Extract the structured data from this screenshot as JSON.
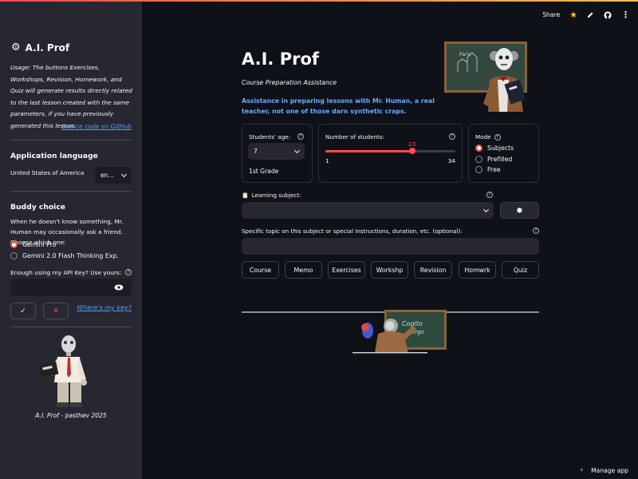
{
  "sidebar": {
    "title": "A.I. Prof",
    "usage": "Usage: The buttons Exercises, Workshops, Revision, Homework, and Quiz will generate results directly related to the last lesson created with the same parameters, if you have previously generated this lesson.",
    "source_link": "Source code on GitHub",
    "app_language_heading": "Application language",
    "language_label": "United States of America",
    "language_value": "en...",
    "buddy_heading": "Buddy choice",
    "buddy_description": "When he doesn't know something, Mr. Human may occasionally ask a friend. Choose which one:",
    "buddy_options": [
      "Gemini Pro",
      "Gemini 2.0 Flash Thinking Exp."
    ],
    "buddy_selected": 0,
    "api_key_label": "Enough using my API Key? Use yours:",
    "confirm_symbol": "✓",
    "cancel_symbol": "✕",
    "where_key_link": "Where's my key?",
    "footer": "A.I. Prof - pasthev 2025"
  },
  "topbar": {
    "share": "Share",
    "icons": [
      "star-icon",
      "edit-icon",
      "github-icon",
      "menu-dots-icon"
    ]
  },
  "main": {
    "title": "A.I. Prof",
    "subtitle": "Course Preparation Assistance",
    "tagline": "Assistance in preparing lessons with Mr. Human, a real teacher, not one of those darn synthetic craps.",
    "age_label": "Students' age:",
    "age_value": "7",
    "grade_text": "1st Grade",
    "students_label": "Number of students:",
    "students_value": 23,
    "students_min": 1,
    "students_max": 34,
    "mode_label": "Mode",
    "mode_options": [
      "Subjects",
      "Prefilled",
      "Free"
    ],
    "mode_selected": 0,
    "subject_label": "Learning subject:",
    "topic_label": "Specific topic on this subject or special instructions, duration, etc. (optional):",
    "action_buttons": [
      "Course",
      "Memo",
      "Exercises",
      "Workshp",
      "Revision",
      "Homwrk",
      "Quiz"
    ],
    "chalkboard_text": [
      "Cogito",
      "ergo"
    ]
  },
  "footer": {
    "manage_app": "Manage app"
  },
  "colors": {
    "accent": "#ff4b4b",
    "link": "#5b9cf5",
    "tagline": "#6ea8fe",
    "sidebar_bg": "#262730",
    "main_bg": "#0e1117"
  }
}
